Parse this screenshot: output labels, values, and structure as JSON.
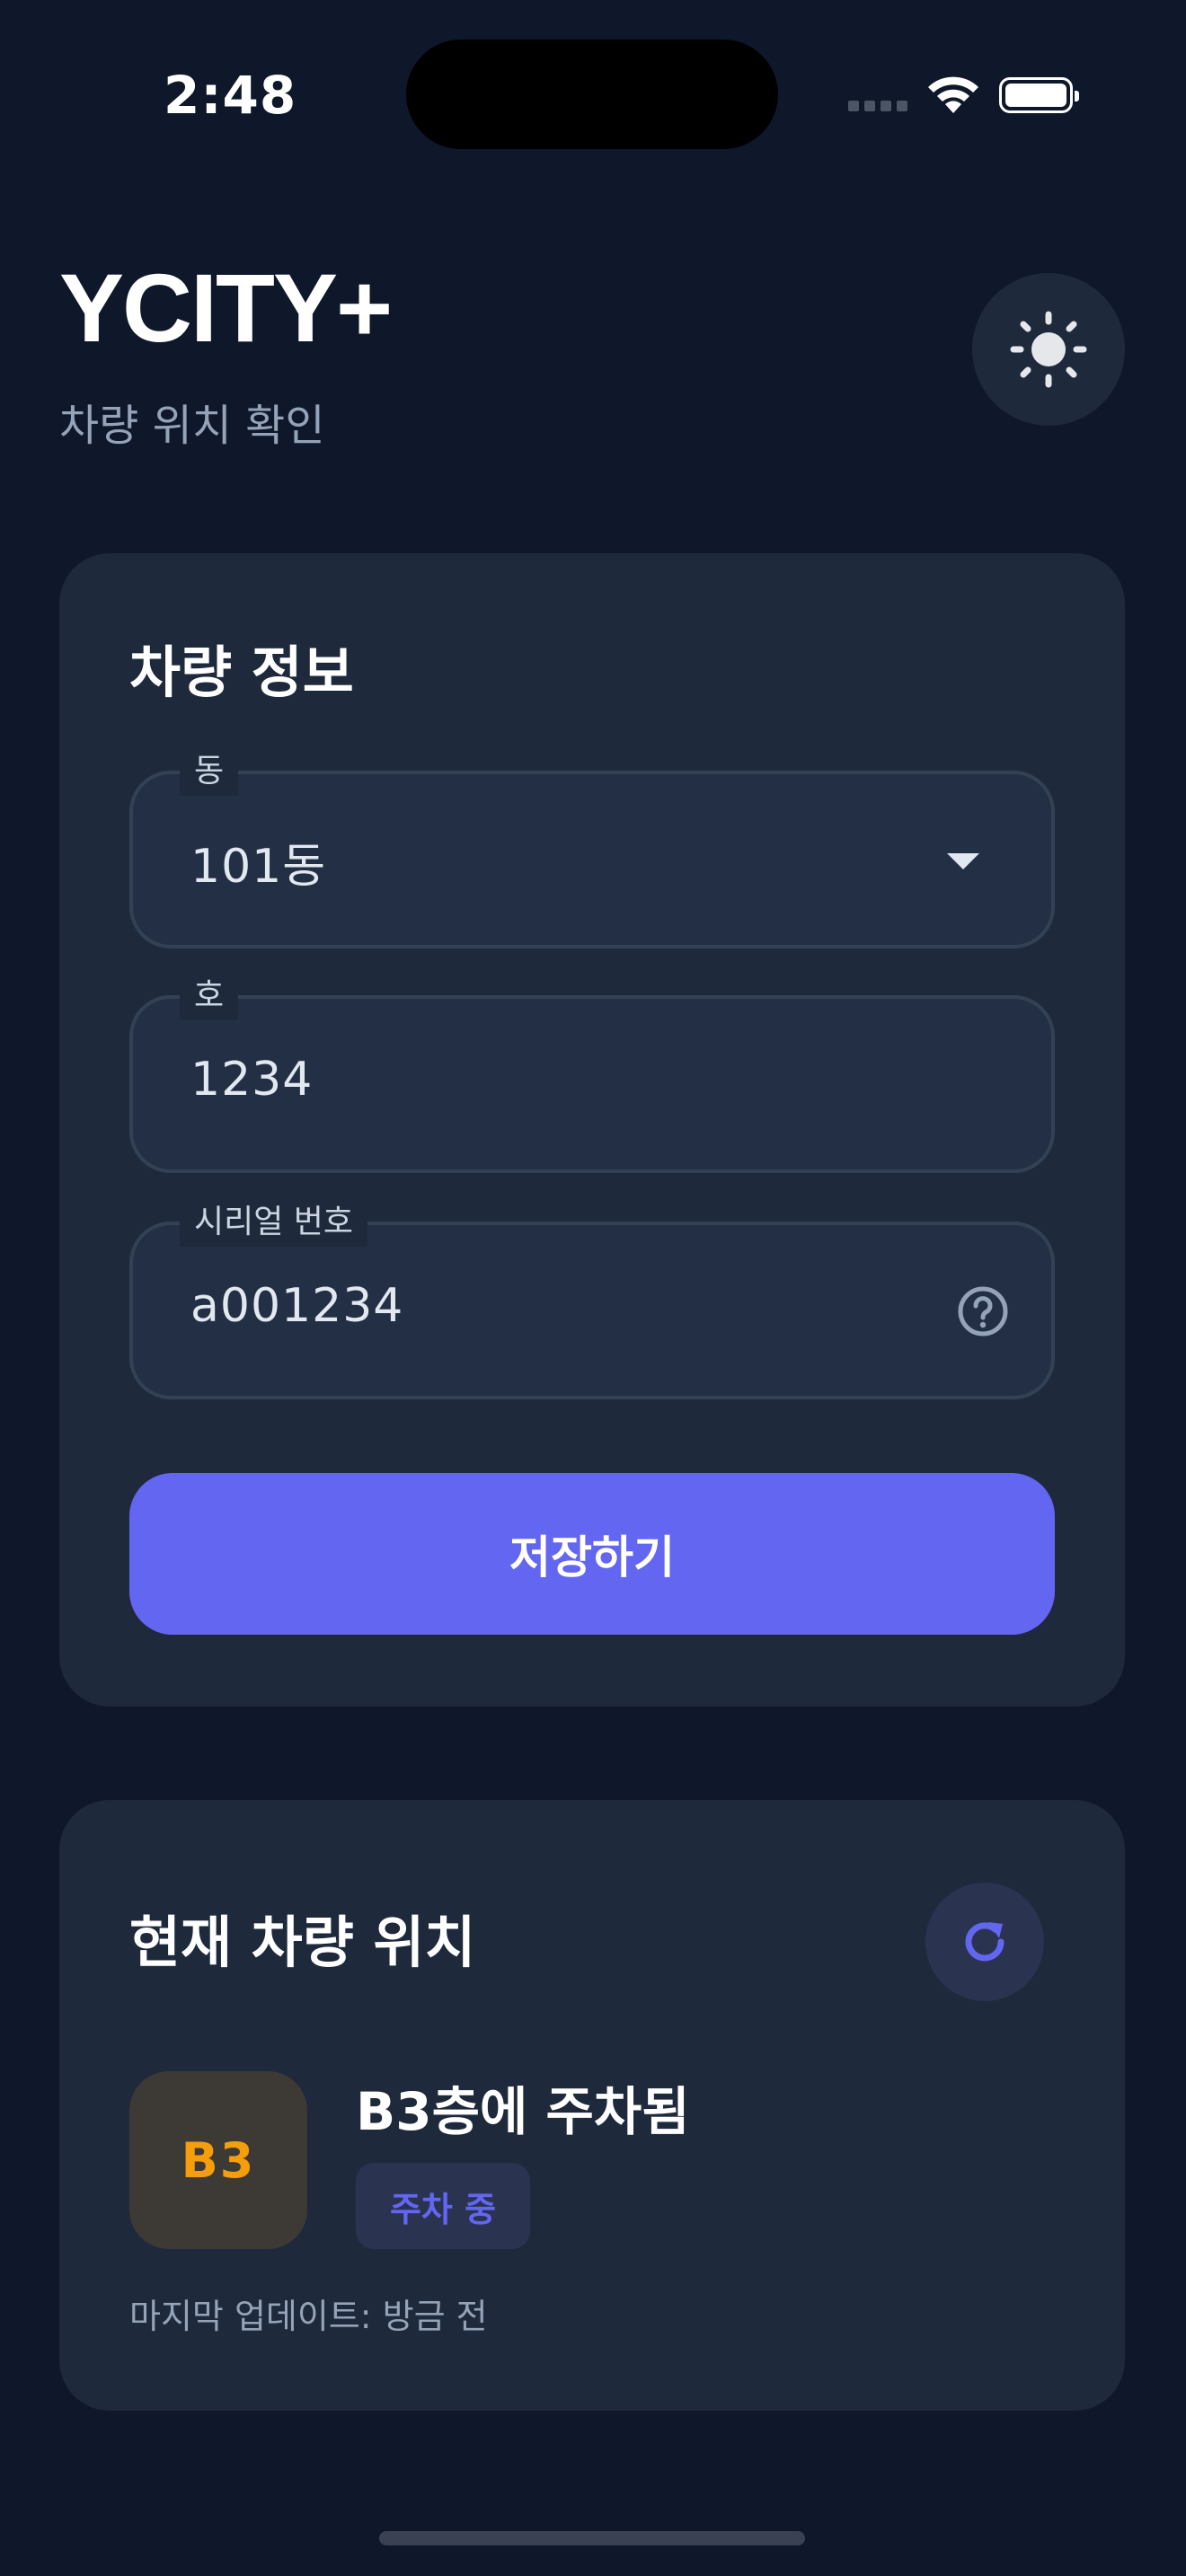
{
  "status_bar": {
    "time": "2:48"
  },
  "header": {
    "title": "YCITY+",
    "subtitle": "차량 위치 확인"
  },
  "icons": {
    "theme_toggle": "sun-icon",
    "help": "help-circle-icon",
    "refresh": "refresh-icon"
  },
  "vehicle_card": {
    "title": "차량 정보",
    "dong": {
      "label": "동",
      "value": "101동"
    },
    "ho": {
      "label": "호",
      "value": "1234"
    },
    "serial": {
      "label": "시리얼 번호",
      "value": "a001234"
    },
    "save_label": "저장하기"
  },
  "location_card": {
    "title": "현재 차량 위치",
    "floor": "B3",
    "parked_text": "B3층에 주차됨",
    "status_badge": "주차 중",
    "last_updated": "마지막 업데이트: 방금 전"
  },
  "colors": {
    "background": "#0f172a",
    "card": "#1e293b",
    "accent": "#6366f1",
    "floor_text": "#f59e0b"
  }
}
